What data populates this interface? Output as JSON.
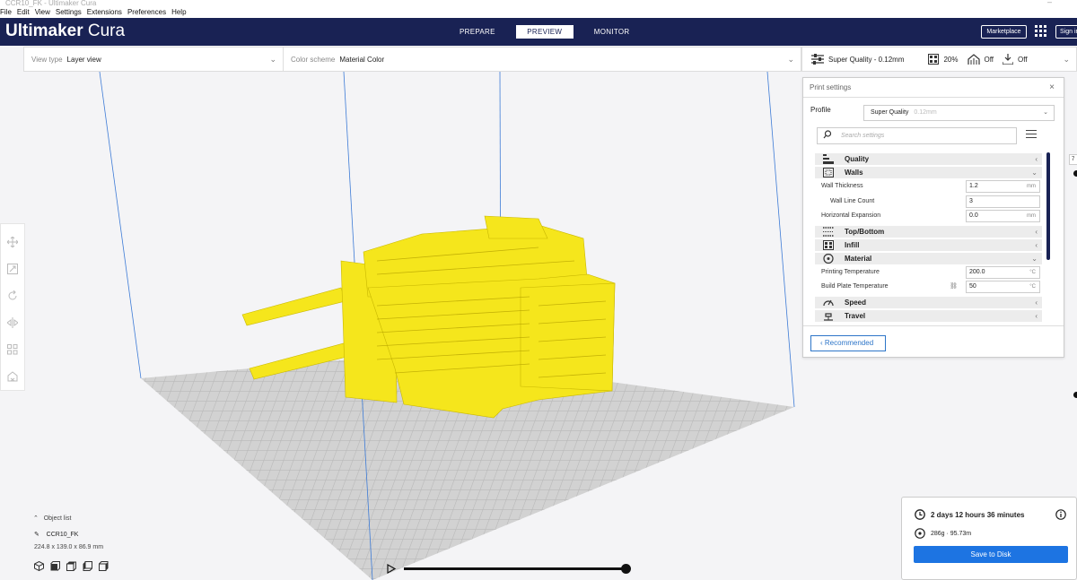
{
  "window": {
    "title": "CCR10_FK - Ultimaker Cura",
    "controls": "–"
  },
  "menubar": [
    "File",
    "Edit",
    "View",
    "Settings",
    "Extensions",
    "Preferences",
    "Help"
  ],
  "header": {
    "logo_bold": "Ultimaker",
    "logo_light": "Cura",
    "stages": [
      {
        "label": "PREPARE",
        "active": false
      },
      {
        "label": "PREVIEW",
        "active": true
      },
      {
        "label": "MONITOR",
        "active": false
      }
    ],
    "marketplace_label": "Marketplace",
    "signin_label": "Sign in"
  },
  "toolbar": {
    "view_type_label": "View type",
    "view_type_value": "Layer view",
    "color_scheme_label": "Color scheme",
    "color_scheme_value": "Material Color",
    "quality": "Super Quality - 0.12mm",
    "infill": "20%",
    "support": "Off",
    "adhesion": "Off"
  },
  "print_settings": {
    "title": "Print settings",
    "close": "×",
    "profile_label": "Profile",
    "profile_value": "Super Quality",
    "profile_hint": "0.12mm",
    "search_placeholder": "Search settings",
    "categories": {
      "quality": "Quality",
      "walls": "Walls",
      "top_bottom": "Top/Bottom",
      "infill": "Infill",
      "material": "Material",
      "speed": "Speed",
      "travel": "Travel"
    },
    "settings": {
      "wall_thickness": {
        "label": "Wall Thickness",
        "value": "1.2",
        "unit": "mm"
      },
      "wall_line_count": {
        "label": "Wall Line Count",
        "value": "3",
        "unit": ""
      },
      "horizontal_expansion": {
        "label": "Horizontal Expansion",
        "value": "0.0",
        "unit": "mm"
      },
      "printing_temperature": {
        "label": "Printing Temperature",
        "value": "200.0",
        "unit": "°C"
      },
      "build_plate_temperature": {
        "label": "Build Plate Temperature",
        "value": "50",
        "unit": "°C"
      }
    },
    "recommended_label": "Recommended"
  },
  "object_list": {
    "header": "Object list",
    "item": "CCR10_FK",
    "dimensions": "224.8 x 139.0 x 86.9 mm"
  },
  "layer_slider": {
    "position": 1.0
  },
  "side_box": "7",
  "estimate": {
    "time": "2 days 12 hours 36 minutes",
    "material": "286g · 95.73m",
    "save_label": "Save to Disk"
  },
  "colors": {
    "header_bg": "#192254",
    "accent_blue": "#1d74e2",
    "model_yellow": "#f5e61c"
  }
}
